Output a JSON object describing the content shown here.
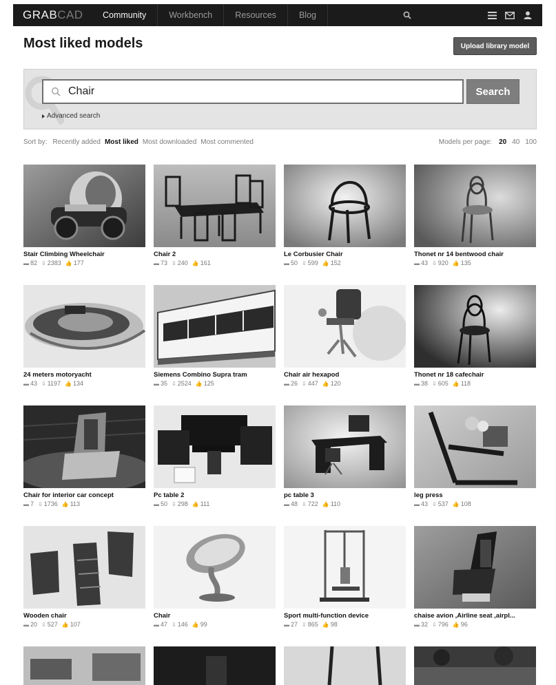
{
  "nav": {
    "logo_main": "GRAB",
    "logo_accent": "CAD",
    "tabs": [
      "Community",
      "Workbench",
      "Resources",
      "Blog"
    ],
    "icons": [
      "search-icon",
      "menu-icon",
      "mail-icon",
      "user-icon"
    ]
  },
  "page": {
    "title": "Most liked models",
    "upload_label": "Upload library model"
  },
  "search": {
    "value": "Chair",
    "button_label": "Search",
    "advanced_label": "Advanced search"
  },
  "sort": {
    "label": "Sort by:",
    "options": [
      "Recently added",
      "Most liked",
      "Most downloaded",
      "Most commented"
    ],
    "selected": "Most liked",
    "per_page_label": "Models per page:",
    "per_page_options": [
      "20",
      "40",
      "100"
    ],
    "per_page_selected": "20"
  },
  "colors": {
    "nav_bg": "#1b1b1b",
    "button_dark": "#5c5c5c",
    "search_button": "#7e7e7e",
    "panel_bg": "#e4e4e4"
  },
  "models": [
    {
      "title": "Stair Climbing Wheelchair",
      "comments": "82",
      "downloads": "2383",
      "likes": "177"
    },
    {
      "title": "Chair 2",
      "comments": "73",
      "downloads": "240",
      "likes": "161"
    },
    {
      "title": "Le Corbusier Chair",
      "comments": "50",
      "downloads": "599",
      "likes": "152"
    },
    {
      "title": "Thonet nr 14 bentwood chair",
      "comments": "43",
      "downloads": "920",
      "likes": "135"
    },
    {
      "title": "24 meters motoryacht",
      "comments": "43",
      "downloads": "1197",
      "likes": "134"
    },
    {
      "title": "Siemens Combino Supra tram",
      "comments": "35",
      "downloads": "2524",
      "likes": "125"
    },
    {
      "title": "Chair air hexapod",
      "comments": "26",
      "downloads": "447",
      "likes": "120"
    },
    {
      "title": "Thonet nr 18 cafechair",
      "comments": "38",
      "downloads": "605",
      "likes": "118"
    },
    {
      "title": "Chair for interior car concept",
      "comments": "7",
      "downloads": "1736",
      "likes": "113"
    },
    {
      "title": "Pc table 2",
      "comments": "50",
      "downloads": "298",
      "likes": "111"
    },
    {
      "title": "pc table 3",
      "comments": "48",
      "downloads": "722",
      "likes": "110"
    },
    {
      "title": "leg press",
      "comments": "43",
      "downloads": "537",
      "likes": "108"
    },
    {
      "title": "Wooden chair",
      "comments": "20",
      "downloads": "527",
      "likes": "107"
    },
    {
      "title": "Chair",
      "comments": "47",
      "downloads": "146",
      "likes": "99"
    },
    {
      "title": "Sport multi-function device",
      "comments": "27",
      "downloads": "865",
      "likes": "98"
    },
    {
      "title": "chaise avion ,Airline seat ,airpl...",
      "comments": "32",
      "downloads": "796",
      "likes": "96"
    }
  ]
}
